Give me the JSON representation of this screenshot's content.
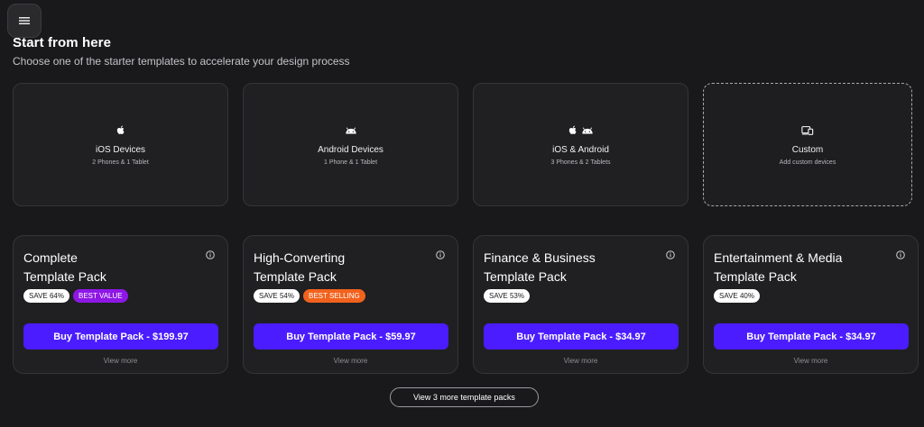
{
  "menu": {
    "icon": "hamburger-menu-icon"
  },
  "header": {
    "title": "Start from here",
    "subtitle": "Choose one of the starter templates to accelerate your design process"
  },
  "devices": [
    {
      "name": "iOS Devices",
      "sub": "2 Phones & 1 Tablet",
      "icons": [
        "apple-icon"
      ]
    },
    {
      "name": "Android Devices",
      "sub": "1 Phone & 1 Tablet",
      "icons": [
        "android-icon"
      ]
    },
    {
      "name": "iOS & Android",
      "sub": "3 Phones & 2 Tablets",
      "icons": [
        "apple-icon",
        "android-icon"
      ]
    },
    {
      "name": "Custom",
      "sub": "Add custom devices",
      "icons": [
        "devices-icon"
      ]
    }
  ],
  "packs": [
    {
      "title_line1": "Complete",
      "title_line2": "Template Pack",
      "save": "SAVE 64%",
      "tag": "BEST VALUE",
      "buy": "Buy Template Pack - $199.97",
      "view_more": "View more"
    },
    {
      "title_line1": "High-Converting",
      "title_line2": "Template Pack",
      "save": "SAVE 54%",
      "tag": "BEST SELLING",
      "buy": "Buy Template Pack - $59.97",
      "view_more": "View more"
    },
    {
      "title_line1": "Finance & Business",
      "title_line2": "Template Pack",
      "save": "SAVE 53%",
      "buy": "Buy Template Pack - $34.97",
      "view_more": "View more"
    },
    {
      "title_line1": "Entertainment & Media",
      "title_line2": "Template Pack",
      "save": "SAVE 40%",
      "buy": "Buy Template Pack - $34.97",
      "view_more": "View more"
    }
  ],
  "more_button": "View 3 more template packs",
  "colors": {
    "background": "#19191b",
    "card": "#202023",
    "accent": "#4a1cff",
    "best_value": "#8e17e6",
    "best_selling": "#f2621d"
  }
}
